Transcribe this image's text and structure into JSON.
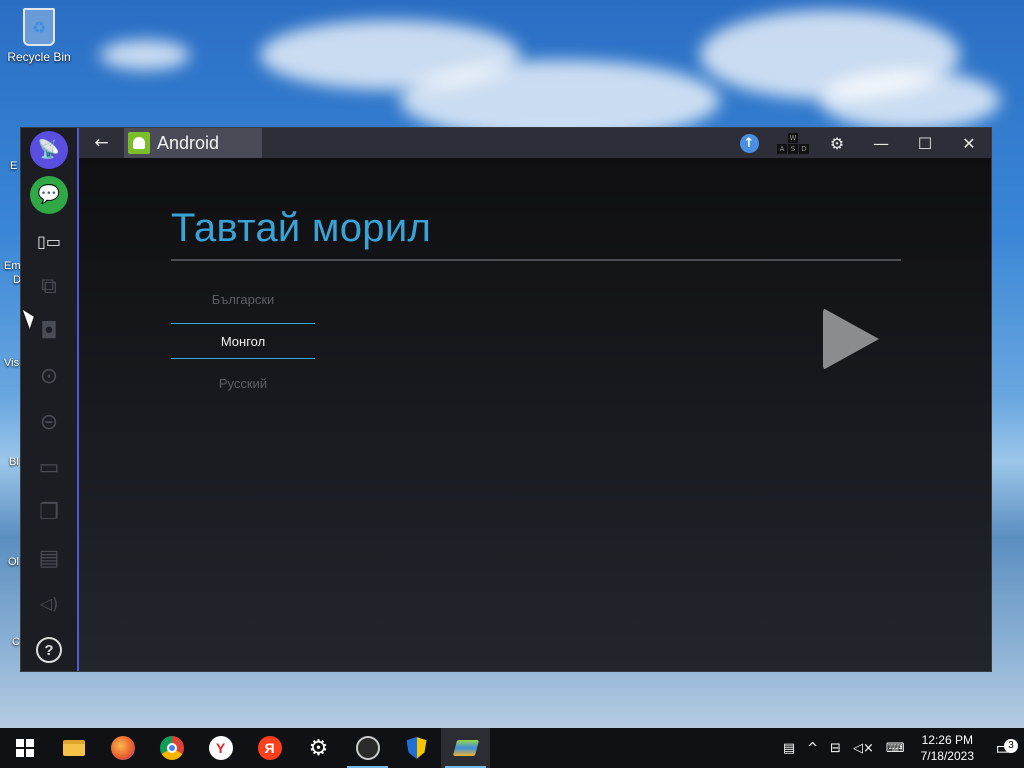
{
  "desktop": {
    "icons": [
      {
        "label": "Recycle Bin",
        "icon": "recycle-bin-icon"
      }
    ],
    "partial_labels": [
      "E",
      "Em",
      "D",
      "Vis",
      "Bl",
      "Ol",
      "C"
    ]
  },
  "window": {
    "tab_label": "Android",
    "titlebar_buttons": {
      "back": "←",
      "update": "↑",
      "settings": "⚙",
      "minimize": "—",
      "maximize": "☐",
      "close": "✕"
    },
    "keymap_keys": [
      "W",
      "A",
      "S",
      "D"
    ]
  },
  "sidebar": {
    "items": [
      {
        "icon": "broadcast-icon",
        "glyph": "📡"
      },
      {
        "icon": "chat-icon",
        "glyph": "💬"
      },
      {
        "icon": "multi-instance-icon",
        "glyph": "▯▭"
      },
      {
        "icon": "shake-icon",
        "glyph": "⧉"
      },
      {
        "icon": "camera-icon",
        "glyph": "◘"
      },
      {
        "icon": "location-icon",
        "glyph": "⊙"
      },
      {
        "icon": "more-icon",
        "glyph": "⊝"
      },
      {
        "icon": "folder-icon",
        "glyph": "▭"
      },
      {
        "icon": "copy-icon",
        "glyph": "❐"
      },
      {
        "icon": "paste-icon",
        "glyph": "▤"
      },
      {
        "icon": "volume-icon",
        "glyph": "◁)"
      },
      {
        "icon": "help-icon",
        "glyph": "?"
      }
    ]
  },
  "android": {
    "title": "Тавтай морил",
    "languages": [
      "Български",
      "Монгол",
      "Русский"
    ],
    "selected_language": "Монгол"
  },
  "taskbar": {
    "apps": [
      "start",
      "file-explorer",
      "firefox",
      "chrome",
      "yandex-browser",
      "yandex",
      "settings",
      "obs",
      "security",
      "bluestacks"
    ],
    "time": "12:26 PM",
    "date": "7/18/2023",
    "notification_count": "3"
  },
  "colors": {
    "title_blue": "#3aa3d6",
    "selection_line": "#37a7d4",
    "sidebar_accent": "#4f5bd5"
  }
}
